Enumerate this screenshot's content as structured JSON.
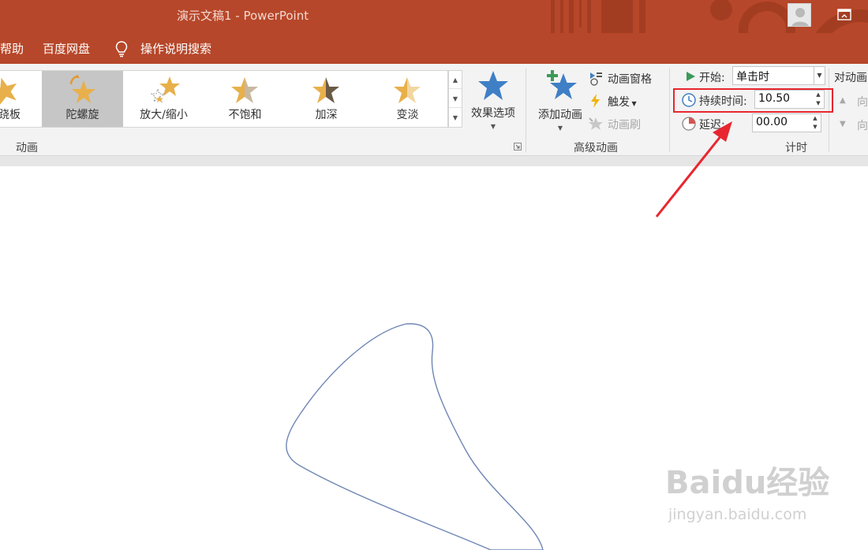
{
  "window": {
    "title": "演示文稿1  -  PowerPoint"
  },
  "menu": {
    "help": "帮助",
    "baidu_pan": "百度网盘",
    "tell_me": "操作说明搜索"
  },
  "ribbon": {
    "animation_group": {
      "label": "动画",
      "gallery": [
        {
          "label": "跷板",
          "selected": false
        },
        {
          "label": "陀螺旋",
          "selected": true
        },
        {
          "label": "放大/缩小",
          "selected": false
        },
        {
          "label": "不饱和",
          "selected": false
        },
        {
          "label": "加深",
          "selected": false
        },
        {
          "label": "变淡",
          "selected": false
        }
      ],
      "effect_options": "效果选项"
    },
    "advanced_group": {
      "label": "高级动画",
      "add_animation": "添加动画",
      "animation_pane": "动画窗格",
      "trigger": "触发",
      "animation_painter": "动画刷"
    },
    "timing_group": {
      "label": "计时",
      "start_label": "开始:",
      "start_value": "单击时",
      "duration_label": "持续时间:",
      "duration_value": "10.50",
      "delay_label": "延迟:",
      "delay_value": "00.00",
      "reorder_label": "对动画",
      "move_earlier": "向",
      "move_later": "向"
    }
  },
  "colors": {
    "title_bar": "#b7472a",
    "ribbon_bg": "#f3f3f3",
    "highlight": "#e8262f",
    "star_gold": "#e8b04a",
    "star_blue": "#3f7fc6",
    "shape_outline": "#6f86b5"
  },
  "watermark": {
    "main": "Baidu经验",
    "sub": "jingyan.baidu.com"
  }
}
